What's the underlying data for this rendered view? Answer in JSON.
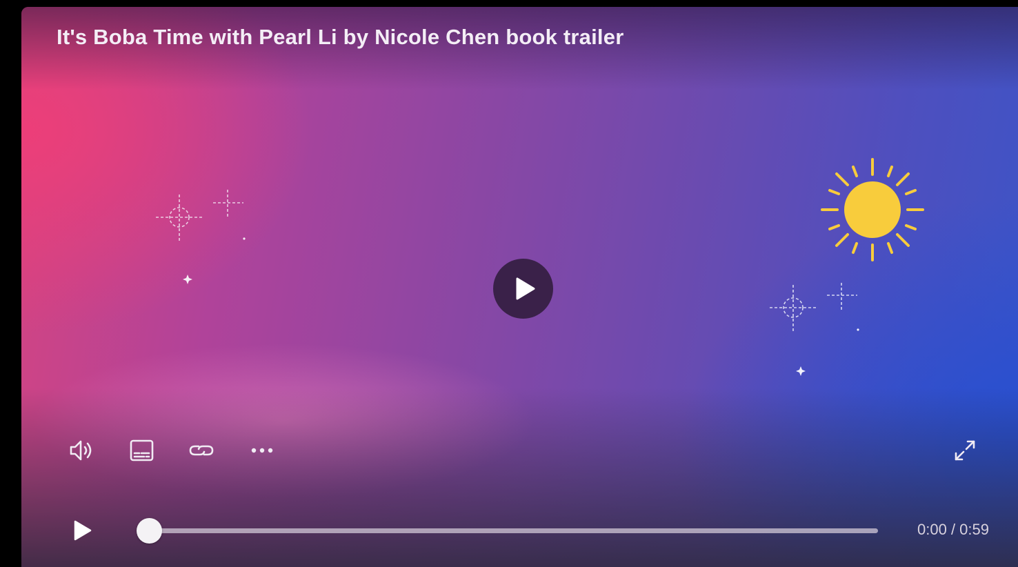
{
  "video": {
    "title": "It's Boba Time with Pearl Li by Nicole Chen book trailer",
    "current_time": "0:00",
    "separator": " / ",
    "duration": "0:59",
    "progress": 0
  },
  "controls": {
    "big_play_icon": "play-icon",
    "volume_icon": "volume-icon",
    "captions_icon": "captions-icon",
    "link_icon": "link-icon",
    "more_icon": "more-horizontal-icon",
    "fullscreen_icon": "expand-icon",
    "play_icon": "play-icon"
  },
  "colors": {
    "sun": "#f8cc3c",
    "play_button_bg": "#3a2149",
    "text": "#f4eef6"
  }
}
